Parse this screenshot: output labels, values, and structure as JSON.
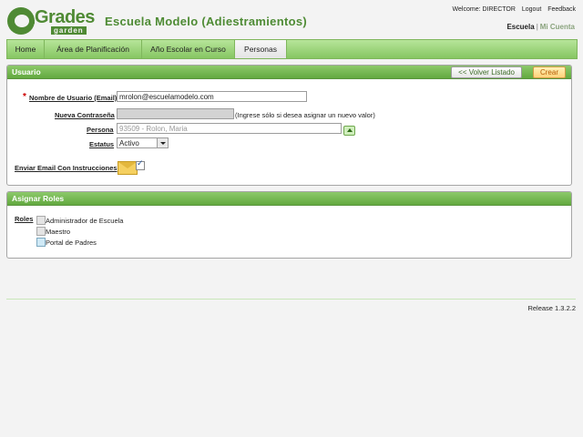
{
  "logo": {
    "text": "Grades",
    "subtext": "garden",
    "brand_color": "#4f8a34"
  },
  "app_title": "Escuela Modelo (Adiestramientos)",
  "toplinks": {
    "welcome": "Welcome: DIRECTOR",
    "logout": "Logout",
    "feedback": "Feedback"
  },
  "school_links": {
    "current": "Escuela",
    "separator": "|",
    "other": "Mi Cuenta"
  },
  "tabs": [
    {
      "label": "Home"
    },
    {
      "label": "Área de Planificación"
    },
    {
      "label": "Año Escolar en Curso"
    },
    {
      "label": "Personas"
    }
  ],
  "usuario_panel": {
    "title": "Usuario",
    "back_label": "<< Volver Listado",
    "create_label": "Crear",
    "required_mark": "*",
    "email_label": "Nombre de Usuario (Email)",
    "email_value": "mrolon@escuelamodelo.com",
    "password_label": "Nueva Contraseña",
    "password_hint": "(Ingrese sólo si desea asignar un nuevo valor)",
    "persona_label": "Persona",
    "persona_value": "93509 - Rolon, Maria",
    "status_label": "Estatus",
    "status_value": "Activo",
    "email_send_label": "Enviar Email Con Instrucciones",
    "email_send_checked": true
  },
  "roles_panel": {
    "title": "Asignar Roles",
    "roles_label": "Roles",
    "roles": [
      {
        "label": "Administrador de Escuela",
        "checked": false
      },
      {
        "label": "Maestro",
        "checked": false
      },
      {
        "label": "Portal de Padres",
        "checked": false
      }
    ]
  },
  "release": "Release 1.3.2.2",
  "colors": {
    "accent_green": "#62a93f",
    "tab_green": "#9ed97b",
    "create_orange": "#ffd27a"
  }
}
